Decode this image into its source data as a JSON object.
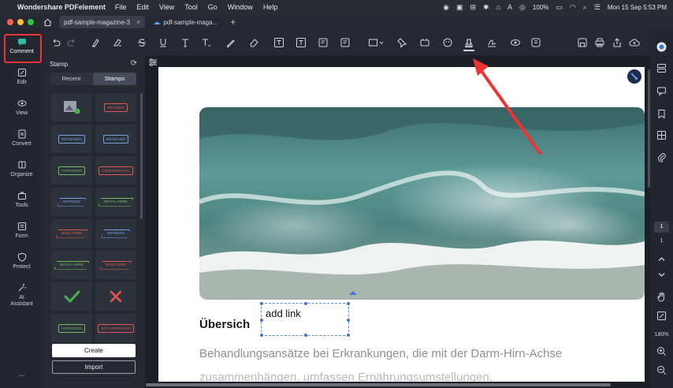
{
  "menubar": {
    "app_name": "Wondershare PDFelement",
    "menus": [
      "File",
      "Edit",
      "View",
      "Tool",
      "Go",
      "Window",
      "Help"
    ],
    "battery": "100%",
    "datetime": "Mon 15 Sep 5:53 PM"
  },
  "tabs": [
    {
      "label": "pdf-sample-magazine-3",
      "active": true
    },
    {
      "label": "pdf-sample-maga...",
      "active": false
    }
  ],
  "left_rail": {
    "items": [
      {
        "label": "Comment",
        "icon": "comment-icon"
      },
      {
        "label": "Edit",
        "icon": "edit-icon"
      },
      {
        "label": "View",
        "icon": "eye-icon"
      },
      {
        "label": "Convert",
        "icon": "convert-icon"
      },
      {
        "label": "Organize",
        "icon": "organize-icon"
      },
      {
        "label": "Tools",
        "icon": "tools-icon"
      },
      {
        "label": "Form",
        "icon": "form-icon"
      },
      {
        "label": "Protect",
        "icon": "shield-icon"
      },
      {
        "label": "AI Assistant",
        "icon": "ai-icon"
      }
    ],
    "more": "..."
  },
  "stamp_panel": {
    "title": "Stamp",
    "tabs": [
      "Recent",
      "Stamps"
    ],
    "active_tab": "Stamps",
    "stamps": [
      {
        "text": "",
        "kind": "image"
      },
      {
        "text": "REVISED",
        "kind": "red"
      },
      {
        "text": "REVIEWED",
        "kind": "blue"
      },
      {
        "text": "RECEIVED",
        "kind": "blue"
      },
      {
        "text": "APPROVED",
        "kind": "green"
      },
      {
        "text": "CONFIDENTIAL",
        "kind": "red"
      },
      {
        "text": "WITNESS",
        "kind": "blue-arrow"
      },
      {
        "text": "INITIAL HERE",
        "kind": "green-arrow"
      },
      {
        "text": "SIGN HERE",
        "kind": "red-arrow"
      },
      {
        "text": "WITNESS",
        "kind": "blue-arrow"
      },
      {
        "text": "INITIAL HERE",
        "kind": "green-arrow"
      },
      {
        "text": "SIGN HERE",
        "kind": "red-arrow"
      },
      {
        "text": "",
        "kind": "check"
      },
      {
        "text": "",
        "kind": "cross"
      },
      {
        "text": "APPROVED",
        "kind": "green"
      },
      {
        "text": "NOT APPROVED",
        "kind": "red"
      }
    ],
    "create_label": "Create",
    "import_label": "Import"
  },
  "document": {
    "heading": "Übersich",
    "link_text": "add link",
    "body_line_1": "Behandlungsansätze bei Erkrankungen, die mit der Darm-Hirn-Achse",
    "body_line_2": "zusammenhängen, umfassen Ernährungsumstellungen,"
  },
  "right_rail": {
    "page_current": "1",
    "page_total": "1",
    "zoom": "180%"
  },
  "colors": {
    "highlight_box": "#ee3333",
    "accent_blue": "#3b7bd8"
  }
}
